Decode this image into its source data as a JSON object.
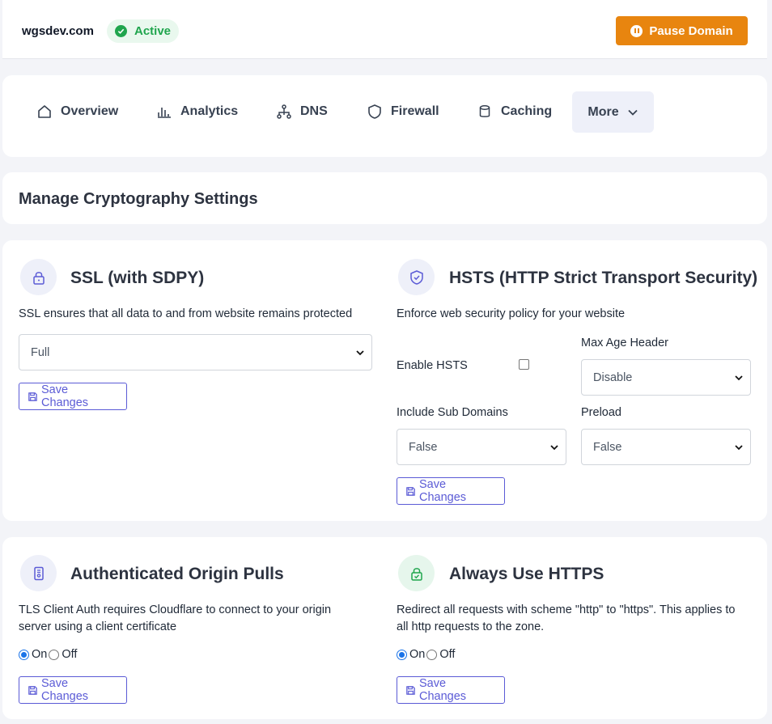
{
  "header": {
    "domain": "wgsdev.com",
    "status": "Active",
    "pause_label": "Pause Domain",
    "colors": {
      "active": "#1fa54d",
      "pause": "#e8850f"
    }
  },
  "nav": {
    "items": [
      {
        "label": "Overview",
        "icon": "home-icon"
      },
      {
        "label": "Analytics",
        "icon": "bar-chart-icon"
      },
      {
        "label": "DNS",
        "icon": "network-icon"
      },
      {
        "label": "Firewall",
        "icon": "shield-icon"
      },
      {
        "label": "Caching",
        "icon": "database-icon"
      }
    ],
    "more_label": "More"
  },
  "page_title": "Manage Cryptography Settings",
  "ssl": {
    "title": "SSL (with SDPY)",
    "description": "SSL ensures that all data to and from website remains protected",
    "selected": "Full",
    "save_label": "Save Changes"
  },
  "hsts": {
    "title": "HSTS (HTTP Strict Transport Security)",
    "description": "Enforce web security policy for your website",
    "enable_label": "Enable HSTS",
    "max_age_label": "Max Age Header",
    "max_age_value": "Disable",
    "subdomains_label": "Include Sub Domains",
    "subdomains_value": "False",
    "preload_label": "Preload",
    "preload_value": "False",
    "save_label": "Save Changes"
  },
  "origin_pulls": {
    "title": "Authenticated Origin Pulls",
    "description_line1": "TLS Client Auth requires Cloudflare to connect to your origin",
    "description_line2": "server using a client certificate",
    "on_label": "On",
    "off_label": "Off",
    "selected": "On",
    "save_label": "Save Changes"
  },
  "https": {
    "title": "Always Use HTTPS",
    "description_line1": "Redirect all requests with scheme \"http\" to \"https\". This applies to",
    "description_line2": "all http requests to the zone.",
    "on_label": "On",
    "off_label": "Off",
    "selected": "On",
    "save_label": "Save Changes"
  }
}
